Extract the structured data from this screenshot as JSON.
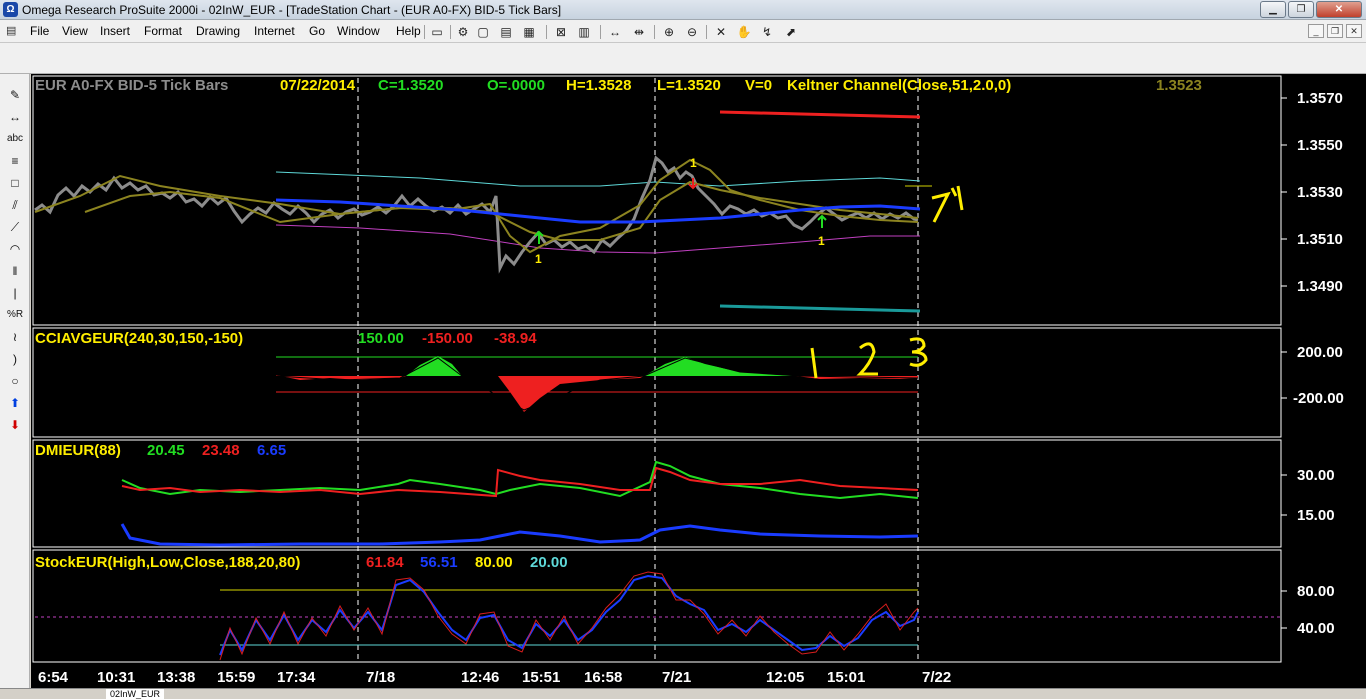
{
  "window": {
    "title": "Omega Research ProSuite 2000i - 02InW_EUR - [TradeStation Chart - (EUR A0-FX)  BID-5 Tick Bars]",
    "app_icon": "omega-icon",
    "controls": [
      "minimize-icon",
      "restore-icon",
      "close-icon"
    ]
  },
  "menu": [
    "File",
    "View",
    "Insert",
    "Format",
    "Drawing",
    "Internet",
    "Go",
    "Window",
    "Help"
  ],
  "toolbar_icons": [
    "new-icon",
    "open-icon",
    "save-icon",
    "print-icon",
    "table-icon",
    "chart-icon",
    "grid-icon",
    "zoom-in-icon",
    "zoom-out-icon",
    "tools-icon",
    "pointer-icon"
  ],
  "drawing_tools": [
    "pencil-icon",
    "arrow-icon",
    "text-icon",
    "lines-icon",
    "rectangle-icon",
    "fibonacci-icon",
    "speed-lines-icon",
    "arc-icon",
    "timezone-icon",
    "vertical-line-icon",
    "percent-icon",
    "curve-icon",
    "ellipse-icon",
    "up-arrow-icon",
    "down-arrow-icon"
  ],
  "price_panel": {
    "symbol": "EUR A0-FX BID-5 Tick Bars",
    "date": "07/22/2014",
    "close": "C=1.3520",
    "open": "O=.0000",
    "high": "H=1.3528",
    "low": "L=1.3520",
    "volume": "V=0",
    "study": "Keltner Channel(Close,51,2.0,0)",
    "study_value": "1.3523",
    "yaxis": [
      "1.3570",
      "1.3550",
      "1.3530",
      "1.3510",
      "1.3490"
    ]
  },
  "cci_panel": {
    "name": "CCIAVGEUR(240,30,150,-150)",
    "v1": "150.00",
    "v2": "-150.00",
    "v3": "-38.94",
    "yaxis": [
      "200.00",
      "-200.00"
    ]
  },
  "dmi_panel": {
    "name": "DMIEUR(88)",
    "v1": "20.45",
    "v2": "23.48",
    "v3": "6.65",
    "yaxis": [
      "30.00",
      "15.00"
    ]
  },
  "stoch_panel": {
    "name": "StockEUR(High,Low,Close,188,20,80)",
    "v1": "61.84",
    "v2": "56.51",
    "v3": "80.00",
    "v4": "20.00",
    "yaxis": [
      "80.00",
      "40.00"
    ]
  },
  "xaxis": [
    "6:54",
    "10:31",
    "13:38",
    "15:59",
    "17:34",
    "7/18",
    "12:46",
    "15:51",
    "16:58",
    "7/21",
    "12:05",
    "15:01",
    "7/22"
  ],
  "annotations": [
    "1",
    "2",
    "3",
    "71"
  ],
  "trade_markers": [
    "1",
    "1",
    "1",
    "1"
  ],
  "status_tab": "02InW_EUR",
  "colors": {
    "background": "#000000",
    "bars": "#8c8c8c",
    "keltner_mid": "#1a3cff",
    "keltner_upper": "#5ed8d8",
    "keltner_lower": "#c040c0",
    "avg": "#8c8420",
    "cci_pos": "#22dd22",
    "cci_neg": "#ee2020",
    "annotation": "#ffee00"
  },
  "chart_data": [
    {
      "type": "line",
      "title": "EUR A0-FX BID-5 Tick Bars",
      "ylim": [
        1.3478,
        1.3582
      ],
      "series": [
        {
          "name": "Keltner Channel(Close,51,2.0,0)",
          "values": [
            1.3524,
            1.3523,
            1.3522,
            1.3521,
            1.3518,
            1.3515,
            1.3515,
            1.3518,
            1.3519,
            1.3519,
            1.352,
            1.3521,
            1.3522,
            1.3523
          ]
        }
      ]
    },
    {
      "type": "area",
      "title": "CCIAVGEUR(240,30,150,-150)",
      "ylim": [
        -320,
        320
      ],
      "series": [
        {
          "name": "CCI",
          "values": [
            -20,
            -30,
            -35,
            -25,
            150,
            -40,
            -180,
            -60,
            -30,
            160,
            40,
            -20,
            -38.94
          ]
        }
      ]
    },
    {
      "type": "line",
      "title": "DMIEUR(88)",
      "ylim": [
        5,
        37
      ],
      "series": [
        {
          "name": "DMI+",
          "values": [
            27,
            23,
            22,
            24,
            24,
            21,
            26,
            25,
            24,
            34,
            24,
            22,
            20.45
          ]
        },
        {
          "name": "DMI-",
          "values": [
            25,
            22,
            23,
            23,
            22,
            22,
            31,
            25,
            24,
            29,
            27,
            23,
            23.48
          ]
        },
        {
          "name": "ADX",
          "values": [
            13,
            8,
            7,
            7,
            7,
            7,
            8,
            10,
            7,
            12,
            10,
            7,
            6.65
          ]
        }
      ]
    },
    {
      "type": "line",
      "title": "StockEUR(High,Low,Close,188,20,80)",
      "ylim": [
        5,
        110
      ],
      "series": [
        {
          "name": "SlowK",
          "values": [
            15,
            35,
            55,
            30,
            40,
            90,
            40,
            25,
            50,
            95,
            50,
            20,
            61.84
          ]
        },
        {
          "name": "SlowD",
          "values": [
            18,
            33,
            52,
            32,
            42,
            88,
            42,
            27,
            48,
            93,
            52,
            22,
            56.51
          ]
        }
      ]
    }
  ]
}
